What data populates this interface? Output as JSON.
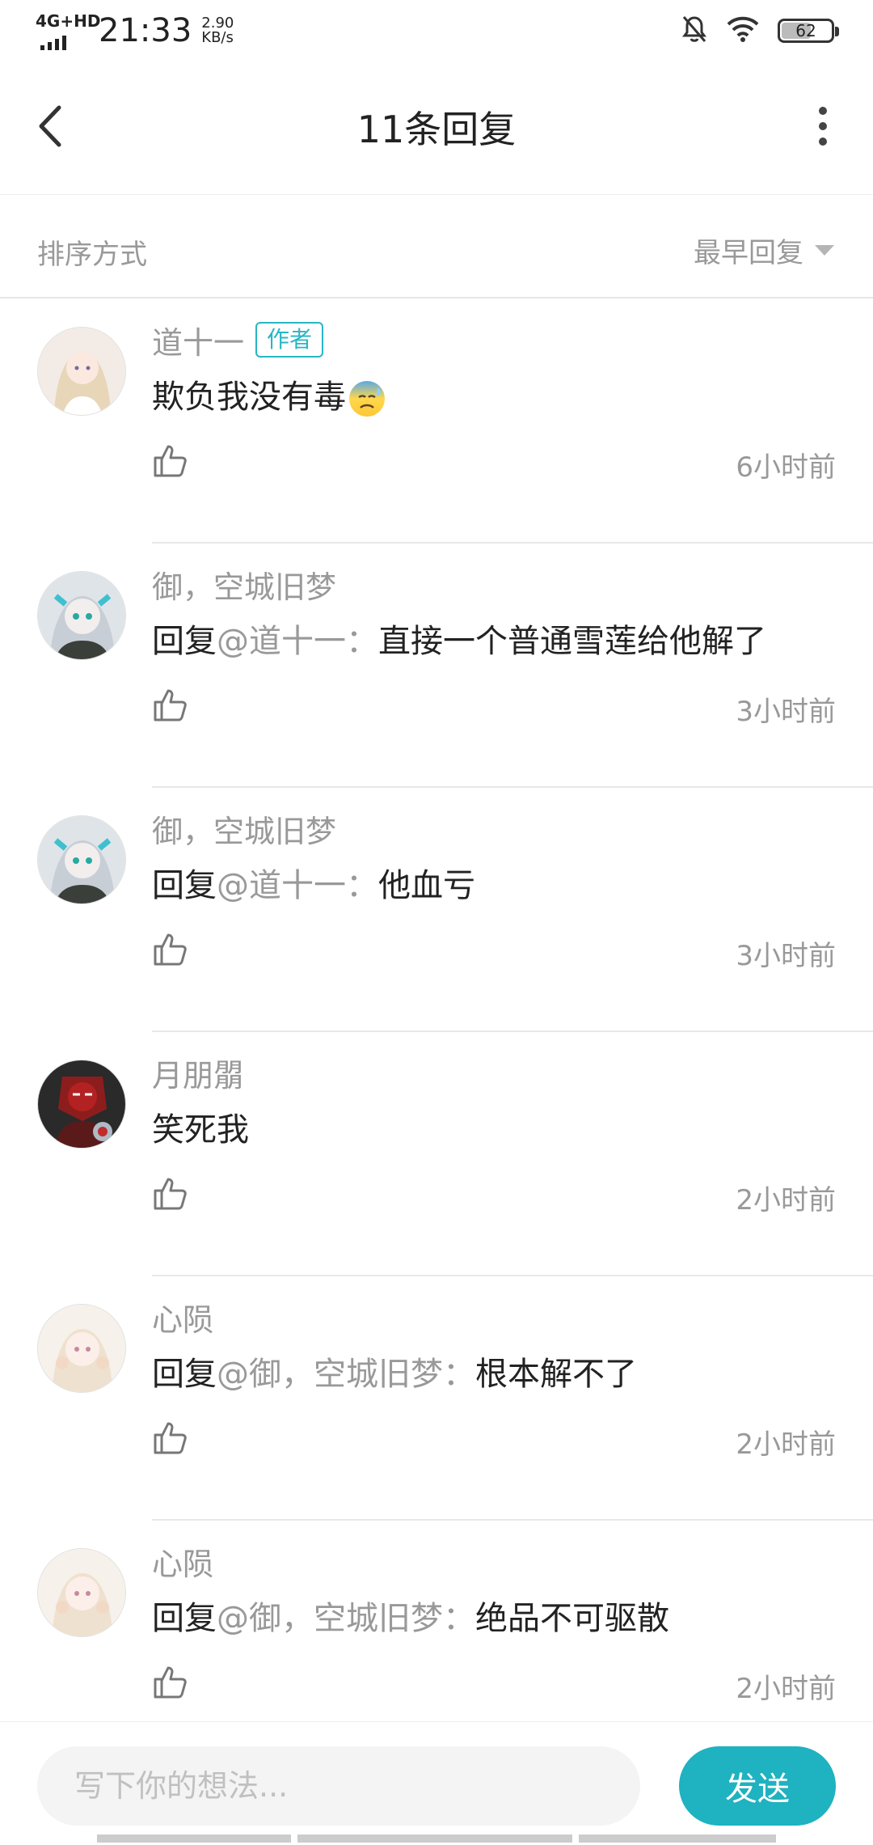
{
  "status": {
    "network": "4G+HD",
    "time": "21:33",
    "speed_value": "2.90",
    "speed_unit": "KB/s",
    "battery": "62",
    "battery_level": 0.62
  },
  "header": {
    "title": "11条回复",
    "back_icon": "chevron-left-icon",
    "more_icon": "more-vertical-icon"
  },
  "sort": {
    "label": "排序方式",
    "selected": "最早回复"
  },
  "replies": [
    {
      "name": "道十一",
      "tag": "作者",
      "prefix": "",
      "at": "",
      "sep": "",
      "text": "欺负我没有毒",
      "emoji": "sweat-emoji",
      "time": "6小时前"
    },
    {
      "name": "御，空城旧梦",
      "tag": "",
      "prefix": "回复",
      "at": "@道十一",
      "sep": "：",
      "text": "直接一个普通雪莲给他解了",
      "emoji": "",
      "time": "3小时前"
    },
    {
      "name": "御，空城旧梦",
      "tag": "",
      "prefix": "回复",
      "at": "@道十一",
      "sep": "：",
      "text": "他血亏",
      "emoji": "",
      "time": "3小时前"
    },
    {
      "name": "月朋朤",
      "tag": "",
      "prefix": "",
      "at": "",
      "sep": "",
      "text": "笑死我",
      "emoji": "",
      "time": "2小时前"
    },
    {
      "name": "心陨",
      "tag": "",
      "prefix": "回复",
      "at": "@御，空城旧梦",
      "sep": "：",
      "text": "根本解不了",
      "emoji": "",
      "time": "2小时前"
    },
    {
      "name": "心陨",
      "tag": "",
      "prefix": "回复",
      "at": "@御，空城旧梦",
      "sep": "：",
      "text": "绝品不可驱散",
      "emoji": "",
      "time": "2小时前"
    }
  ],
  "composer": {
    "placeholder": "写下你的想法...",
    "value": "",
    "send_label": "发送"
  },
  "colors": {
    "accent": "#1fb2c0",
    "secondary_text": "#999999",
    "primary_text": "#222222"
  }
}
